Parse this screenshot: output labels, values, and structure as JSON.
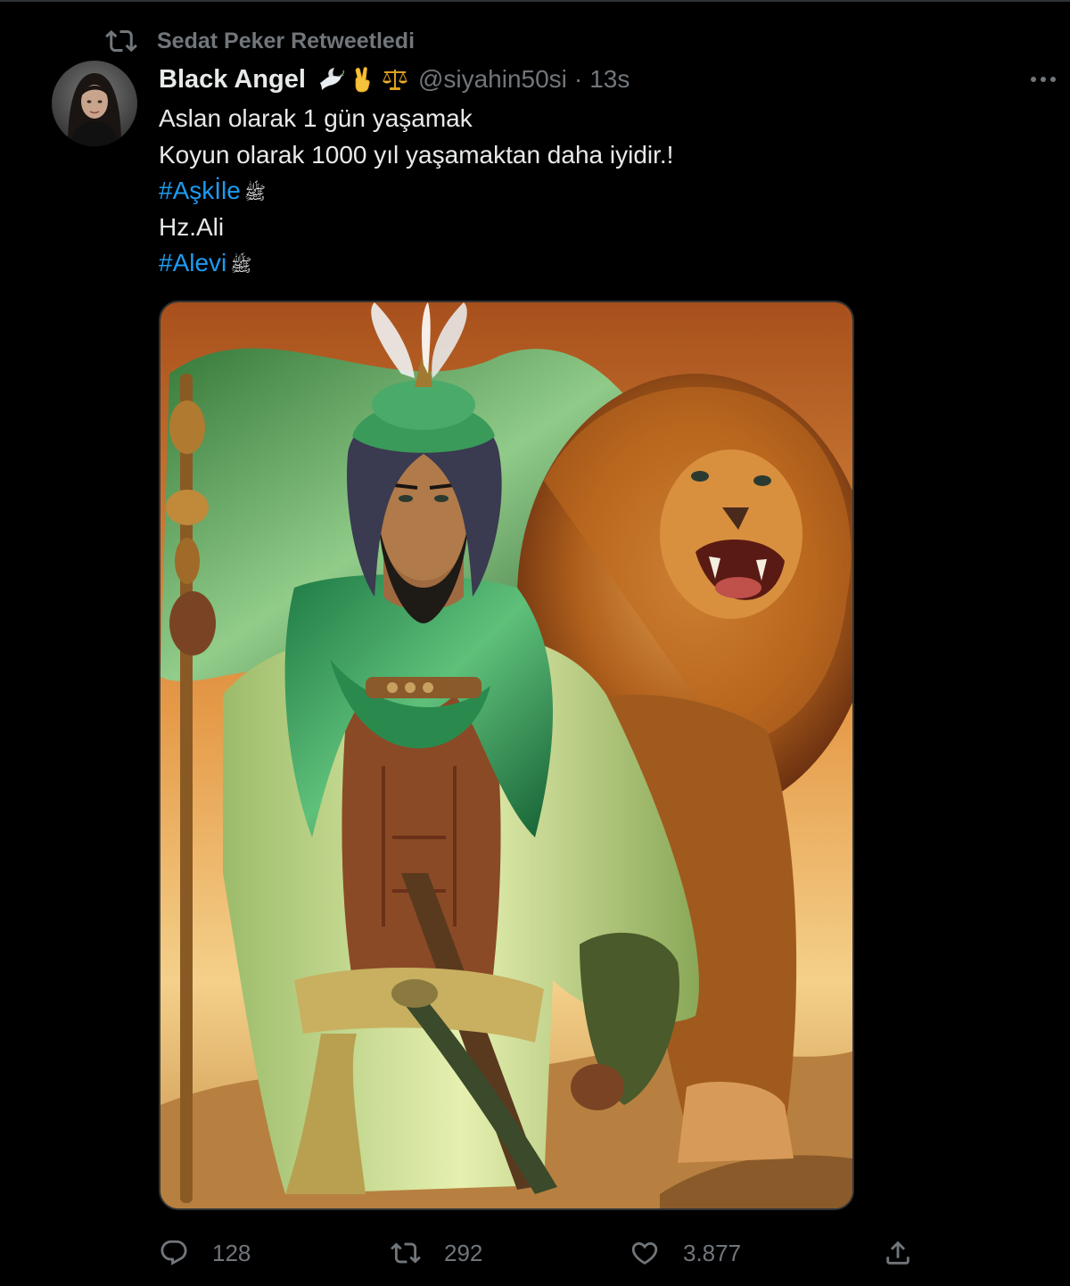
{
  "retweet": {
    "icon": "retweet-icon",
    "label": "Sedat Peker Retweetledi"
  },
  "author": {
    "display_name": "Black Angel",
    "name_emojis": [
      "dove-icon",
      "victory-hand-icon",
      "balance-scale-icon"
    ],
    "handle": "@siyahin50si",
    "separator": "·",
    "time": "13s"
  },
  "more_icon": "more-icon",
  "tweet": {
    "lines": [
      {
        "text": "Aslan olarak 1 gün yaşamak"
      },
      {
        "text": "Koyun olarak 1000 yıl yaşamaktan daha iyidir.!"
      },
      {
        "hashtag": "#Aşkİle",
        "suffix": "ﷺ"
      },
      {
        "text": "Hz.Ali"
      },
      {
        "hashtag": "#Alevi",
        "suffix": "ﷺ"
      }
    ]
  },
  "actions": {
    "reply": {
      "icon": "reply-icon",
      "count": "128"
    },
    "retweet": {
      "icon": "retweet-icon",
      "count": "292"
    },
    "like": {
      "icon": "heart-icon",
      "count": "3.877"
    },
    "share": {
      "icon": "share-icon"
    }
  },
  "colors": {
    "background": "#000000",
    "text": "#e7e9ea",
    "muted": "#71767b",
    "link": "#1d9bf0"
  }
}
